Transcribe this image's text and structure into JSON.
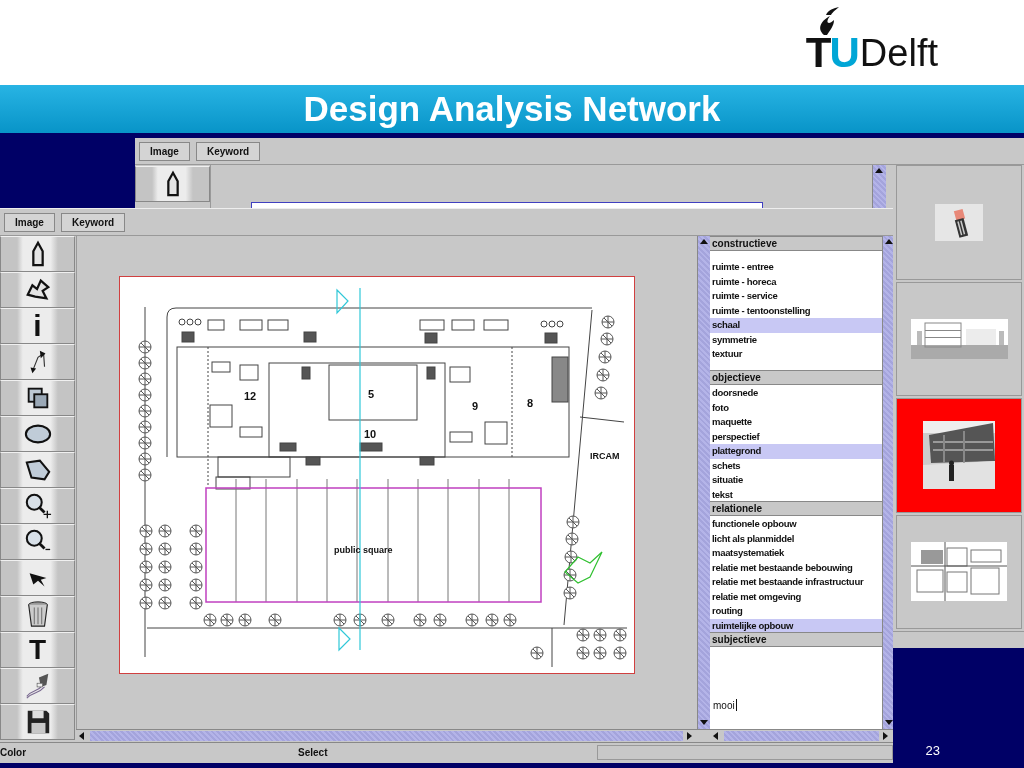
{
  "slide": {
    "logo": {
      "mark": "TU",
      "name": "Delft"
    },
    "title": "Design Analysis Network",
    "page_number": "23"
  },
  "back_window": {
    "toolbar": [
      "Image",
      "Keyword"
    ],
    "thumbnails": [
      {
        "kind": "picture",
        "selected": false
      },
      {
        "kind": "picture",
        "selected": false
      },
      {
        "kind": "picture",
        "selected": true
      },
      {
        "kind": "picture",
        "selected": false
      }
    ]
  },
  "front_window": {
    "toolbar": [
      "Image",
      "Keyword"
    ],
    "tools": [
      {
        "kind": "house-shape"
      },
      {
        "kind": "freeform"
      },
      {
        "kind": "info",
        "glyph": "i"
      },
      {
        "kind": "points"
      },
      {
        "kind": "overlap"
      },
      {
        "kind": "ellipse"
      },
      {
        "kind": "polygon"
      },
      {
        "kind": "zoom-in"
      },
      {
        "kind": "zoom-out"
      },
      {
        "kind": "pointer"
      },
      {
        "kind": "trash"
      },
      {
        "kind": "text",
        "glyph": "T"
      },
      {
        "kind": "pen"
      },
      {
        "kind": "save"
      }
    ],
    "plan_labels": [
      "12",
      "5",
      "10",
      "9",
      "8",
      "IRCAM",
      "public square"
    ],
    "keyword_groups": [
      {
        "title": "constructieve",
        "kind": "list",
        "items": [
          {
            "label": "ruimte - entree",
            "selected": false
          },
          {
            "label": "ruimte - horeca",
            "selected": false
          },
          {
            "label": "ruimte - service",
            "selected": false
          },
          {
            "label": "ruimte - tentoonstelling",
            "selected": false
          },
          {
            "label": "schaal",
            "selected": true
          },
          {
            "label": "symmetrie",
            "selected": false
          },
          {
            "label": "textuur",
            "selected": false
          }
        ]
      },
      {
        "title": "objectieve",
        "kind": "list",
        "items": [
          {
            "label": "doorsnede",
            "selected": false
          },
          {
            "label": "foto",
            "selected": false
          },
          {
            "label": "maquette",
            "selected": false
          },
          {
            "label": "perspectief",
            "selected": false
          },
          {
            "label": "plattegrond",
            "selected": true
          },
          {
            "label": "schets",
            "selected": false
          },
          {
            "label": "situatie",
            "selected": false
          },
          {
            "label": "tekst",
            "selected": false
          }
        ]
      },
      {
        "title": "relationele",
        "kind": "list",
        "items": [
          {
            "label": "functionele opbouw",
            "selected": false
          },
          {
            "label": "licht als planmiddel",
            "selected": false
          },
          {
            "label": "maatsystematiek",
            "selected": false
          },
          {
            "label": "relatie met bestaande bebouwing",
            "selected": false
          },
          {
            "label": "relatie met bestaande infrastructuur",
            "selected": false
          },
          {
            "label": "relatie met omgeving",
            "selected": false
          },
          {
            "label": "routing",
            "selected": false
          },
          {
            "label": "ruimtelijke opbouw",
            "selected": true
          }
        ]
      },
      {
        "title": "subjectieve",
        "kind": "text",
        "value": "mooi"
      }
    ],
    "status_bar": {
      "left": "Color",
      "middle": "Select"
    }
  }
}
